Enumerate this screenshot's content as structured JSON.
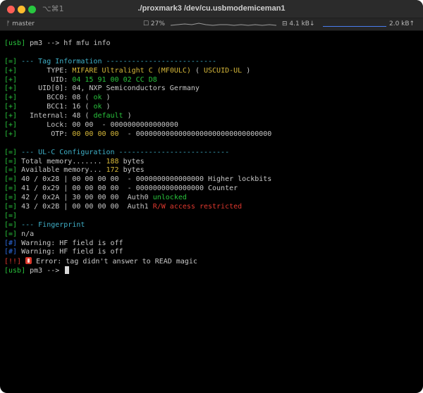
{
  "window": {
    "shortcut": "⌥⌘1",
    "title": "./proxmark3 /dev/cu.usbmodemiceman1"
  },
  "statusbar": {
    "branch": "ᚠ master",
    "cpu": "☐ 27%",
    "net_down": "⊟ 4.1 kB↓",
    "net_up": "2.0 kB↑"
  },
  "terminal": {
    "lines": [
      [
        [
          "g",
          "[usb]"
        ],
        [
          "w",
          " pm3 --> hf mfu info"
        ]
      ],
      [
        [
          "w",
          ""
        ]
      ],
      [
        [
          "g",
          "[=]"
        ],
        [
          "c",
          " --- Tag Information --------------------------"
        ]
      ],
      [
        [
          "g",
          "[+]"
        ],
        [
          "w",
          "       TYPE: "
        ],
        [
          "y",
          "MIFARE Ultralight C (MF0ULC)"
        ],
        [
          "w",
          " ( "
        ],
        [
          "y",
          "USCUID-UL"
        ],
        [
          "w",
          " )"
        ]
      ],
      [
        [
          "g",
          "[+]"
        ],
        [
          "w",
          "        UID: "
        ],
        [
          "g",
          "04 15 91 00 02 CC D8"
        ]
      ],
      [
        [
          "g",
          "[+]"
        ],
        [
          "w",
          "     UID[0]: 04, NXP Semiconductors Germany"
        ]
      ],
      [
        [
          "g",
          "[+]"
        ],
        [
          "w",
          "       BCC0: 08 ( "
        ],
        [
          "g",
          "ok"
        ],
        [
          "w",
          " )"
        ]
      ],
      [
        [
          "g",
          "[+]"
        ],
        [
          "w",
          "       BCC1: 16 ( "
        ],
        [
          "g",
          "ok"
        ],
        [
          "w",
          " )"
        ]
      ],
      [
        [
          "g",
          "[+]"
        ],
        [
          "w",
          "   Internal: 48 ( "
        ],
        [
          "g",
          "default"
        ],
        [
          "w",
          " )"
        ]
      ],
      [
        [
          "g",
          "[+]"
        ],
        [
          "w",
          "       Lock: 00 00  - 0000000000000000"
        ]
      ],
      [
        [
          "g",
          "[+]"
        ],
        [
          "w",
          "        OTP: "
        ],
        [
          "y",
          "00 00 00 00"
        ],
        [
          "w",
          "  - 00000000000000000000000000000000"
        ]
      ],
      [
        [
          "w",
          ""
        ]
      ],
      [
        [
          "g",
          "[=]"
        ],
        [
          "c",
          " --- UL-C Configuration --------------------------"
        ]
      ],
      [
        [
          "g",
          "[=]"
        ],
        [
          "w",
          " Total memory....... "
        ],
        [
          "y",
          "188"
        ],
        [
          "w",
          " bytes"
        ]
      ],
      [
        [
          "g",
          "[=]"
        ],
        [
          "w",
          " Available memory... "
        ],
        [
          "y",
          "172"
        ],
        [
          "w",
          " bytes"
        ]
      ],
      [
        [
          "g",
          "[=]"
        ],
        [
          "w",
          " 40 / 0x28 | 00 00 00 00  - 0000000000000000 Higher lockbits"
        ]
      ],
      [
        [
          "g",
          "[=]"
        ],
        [
          "w",
          " 41 / 0x29 | 00 00 00 00  - 0000000000000000 Counter"
        ]
      ],
      [
        [
          "g",
          "[=]"
        ],
        [
          "w",
          " 42 / 0x2A | 30 00 00 00  Auth0 "
        ],
        [
          "g",
          "unlocked"
        ]
      ],
      [
        [
          "g",
          "[=]"
        ],
        [
          "w",
          " 43 / 0x2B | 00 00 00 00  Auth1 "
        ],
        [
          "r",
          "R/W access restricted"
        ]
      ],
      [
        [
          "g",
          "[=]"
        ]
      ],
      [
        [
          "g",
          "[=]"
        ],
        [
          "c",
          " --- Fingerprint"
        ]
      ],
      [
        [
          "g",
          "[=]"
        ],
        [
          "w",
          " n/a"
        ]
      ],
      [
        [
          "b",
          "[#]"
        ],
        [
          "w",
          " Warning: HF field is off"
        ]
      ],
      [
        [
          "b",
          "[#]"
        ],
        [
          "w",
          " Warning: HF field is off"
        ]
      ],
      [
        [
          "e",
          "[!!]"
        ],
        [
          "w",
          " "
        ],
        [
          "icon",
          "error-icon"
        ],
        [
          "w",
          " Error: tag didn't answer to READ magic"
        ]
      ],
      [
        [
          "g",
          "[usb]"
        ],
        [
          "w",
          " pm3 --> "
        ],
        [
          "cursor",
          ""
        ]
      ]
    ]
  }
}
